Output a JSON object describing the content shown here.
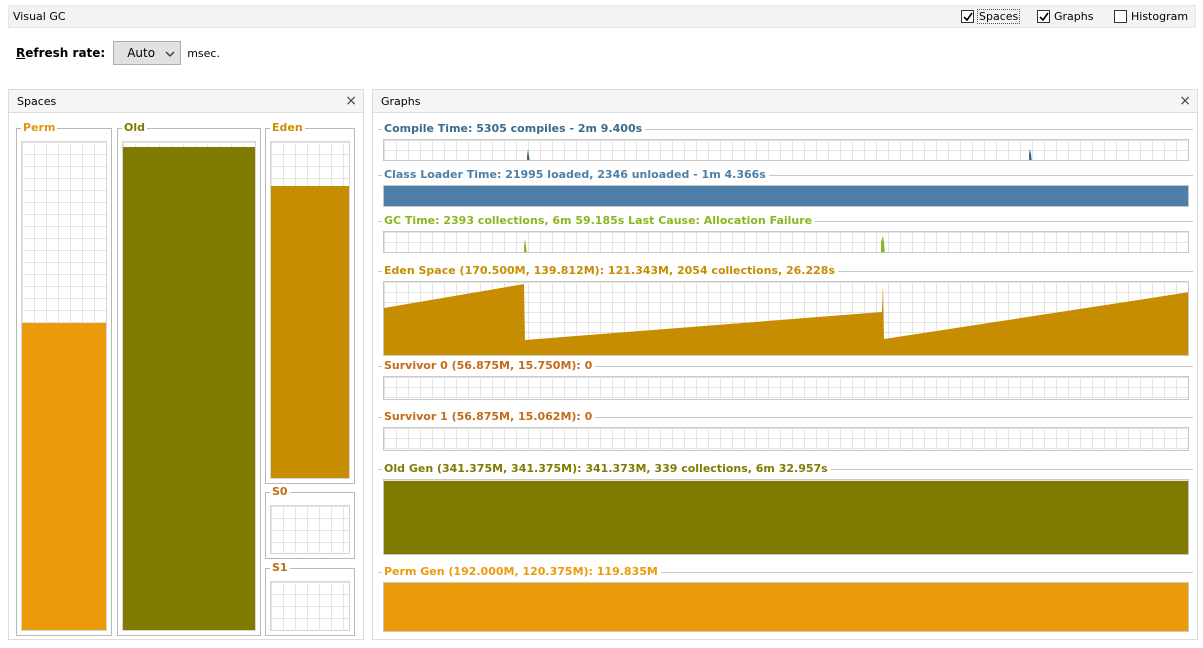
{
  "window": {
    "title": "Visual GC"
  },
  "view_options": [
    {
      "label": "Spaces",
      "checked": true
    },
    {
      "label": "Graphs",
      "checked": true
    },
    {
      "label": "Histogram",
      "checked": false
    }
  ],
  "refresh": {
    "label_prefix": "R",
    "label_rest": "efresh rate:",
    "value": "Auto",
    "unit": "msec."
  },
  "spaces_panel": {
    "title": "Spaces",
    "close": "×",
    "items": [
      {
        "label": "Perm",
        "color": "#eb9a0a",
        "label_color": "#e5940f",
        "fill": 0.63
      },
      {
        "label": "Old",
        "color": "#807a00",
        "label_color": "#807a00",
        "fill": 0.99
      },
      {
        "label": "Eden",
        "color": "#c78d00",
        "label_color": "#d18d00",
        "fill": 0.87
      },
      {
        "label": "S0",
        "color": "#c26b1a",
        "label_color": "#c26b1a",
        "fill": 0
      },
      {
        "label": "S1",
        "color": "#c26b1a",
        "label_color": "#c26b1a",
        "fill": 0
      }
    ]
  },
  "graphs_panel": {
    "title": "Graphs",
    "close": "×",
    "graphs": [
      {
        "label": "Compile Time: 5305 compiles - 2m 9.400s",
        "color": "#3a6c8c"
      },
      {
        "label": "Class Loader Time: 21995 loaded, 2346 unloaded - 1m 4.366s",
        "color": "#4d7fa8"
      },
      {
        "label": "GC Time: 2393 collections, 6m 59.185s  Last Cause: Allocation Failure",
        "color": "#8db51f"
      },
      {
        "label": "Eden Space (170.500M, 139.812M): 121.343M, 2054 collections, 26.228s",
        "color": "#c78d00"
      },
      {
        "label": "Survivor 0 (56.875M, 15.750M): 0",
        "color": "#c26b1a"
      },
      {
        "label": "Survivor 1 (56.875M, 15.062M): 0",
        "color": "#c26b1a"
      },
      {
        "label": "Old Gen (341.375M, 341.375M): 341.373M, 339 collections, 6m 32.957s",
        "color": "#807a00"
      },
      {
        "label": "Perm Gen (192.000M, 120.375M): 119.835M",
        "color": "#eb9a0a"
      }
    ]
  }
}
